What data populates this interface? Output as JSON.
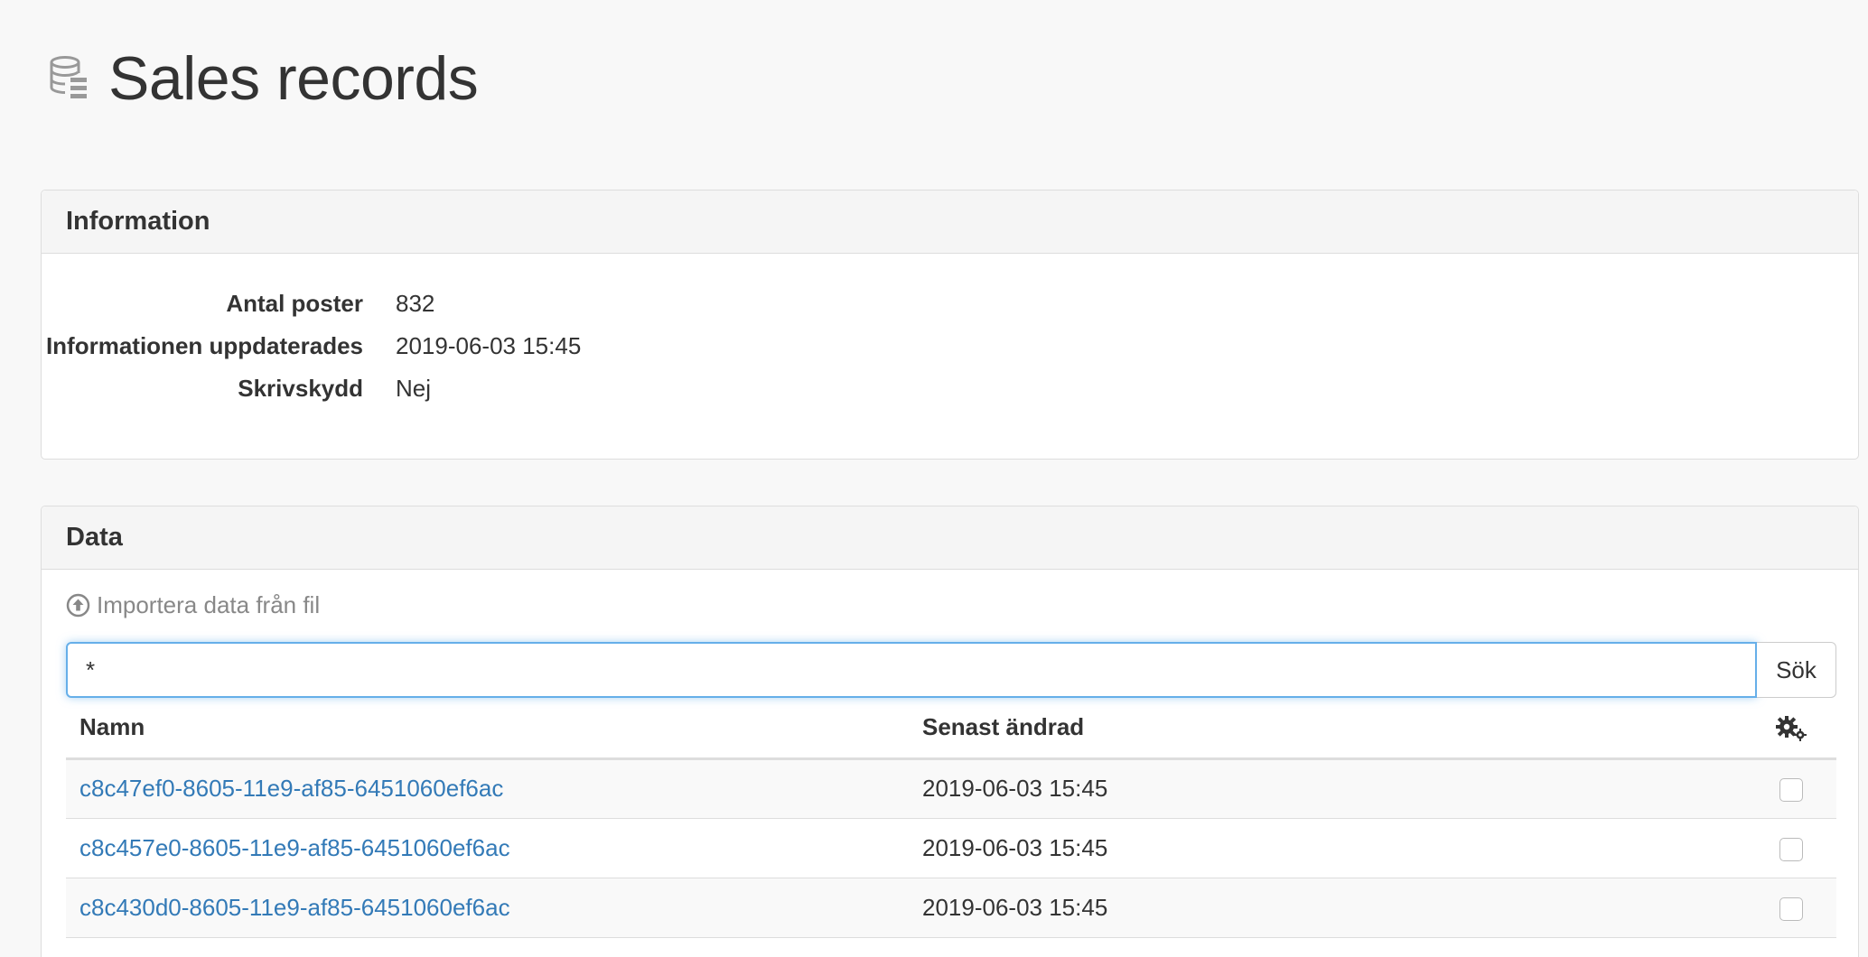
{
  "page": {
    "title": "Sales records",
    "icon": "database-icon"
  },
  "info_panel": {
    "title": "Information",
    "rows": [
      {
        "label": "Antal poster",
        "value": "832"
      },
      {
        "label": "Informationen uppdaterades",
        "value": "2019-06-03 15:45"
      },
      {
        "label": "Skrivskydd",
        "value": "Nej"
      }
    ]
  },
  "data_panel": {
    "title": "Data",
    "import_label": "Importera data från fil",
    "import_icon": "upload-circle-icon",
    "search": {
      "value": "*",
      "button_label": "Sök"
    },
    "table": {
      "columns": [
        "Namn",
        "Senast ändrad"
      ],
      "actions_icon": "gears-icon",
      "rows": [
        {
          "name": "c8c47ef0-8605-11e9-af85-6451060ef6ac",
          "modified": "2019-06-03 15:45",
          "checked": false
        },
        {
          "name": "c8c457e0-8605-11e9-af85-6451060ef6ac",
          "modified": "2019-06-03 15:45",
          "checked": false
        },
        {
          "name": "c8c430d0-8605-11e9-af85-6451060ef6ac",
          "modified": "2019-06-03 15:45",
          "checked": false
        }
      ]
    }
  },
  "colors": {
    "link": "#337ab7",
    "focus_border": "#66afe9",
    "panel_heading_bg": "#f5f5f5",
    "page_bg": "#f8f8f8",
    "muted_text": "#888888"
  }
}
